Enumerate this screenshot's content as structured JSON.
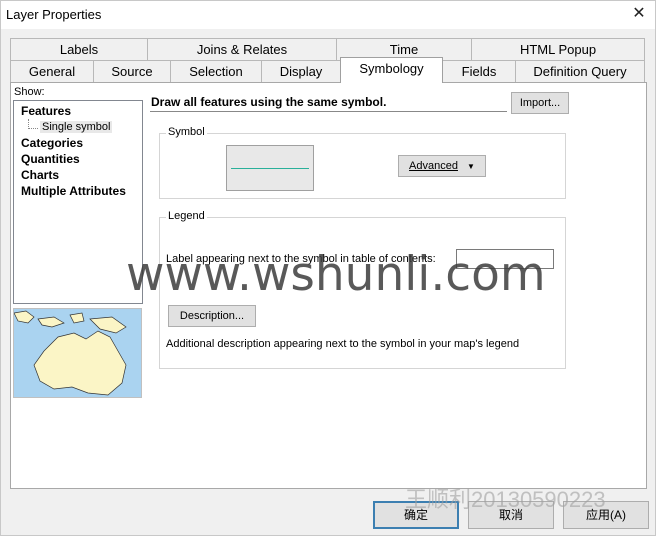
{
  "window": {
    "title": "Layer Properties",
    "close_glyph": "✕"
  },
  "tabs_row1": [
    "Labels",
    "Joins & Relates",
    "Time",
    "HTML Popup"
  ],
  "tabs_row2": [
    "General",
    "Source",
    "Selection",
    "Display",
    "Symbology",
    "Fields",
    "Definition Query"
  ],
  "active_tab": "Symbology",
  "show": {
    "label": "Show:",
    "items": [
      "Features",
      "Categories",
      "Quantities",
      "Charts",
      "Multiple Attributes"
    ],
    "sub_item": "Single symbol"
  },
  "symbology": {
    "heading": "Draw all features using the same symbol.",
    "import_label": "Import...",
    "symbol_group": "Symbol",
    "advanced_label": "Advanced",
    "line_color": "#2ab09a",
    "legend_group": "Legend",
    "label_prompt": "Label appearing next to the symbol in table of contents:",
    "label_value": "",
    "description_button": "Description...",
    "description_note": "Additional description appearing next to the symbol in your map's legend"
  },
  "footer": {
    "ok": "确定",
    "cancel": "取消",
    "apply": "应用(A)"
  },
  "watermark": {
    "main": "www.wshunli.com",
    "small": "王顺利20130590223"
  }
}
